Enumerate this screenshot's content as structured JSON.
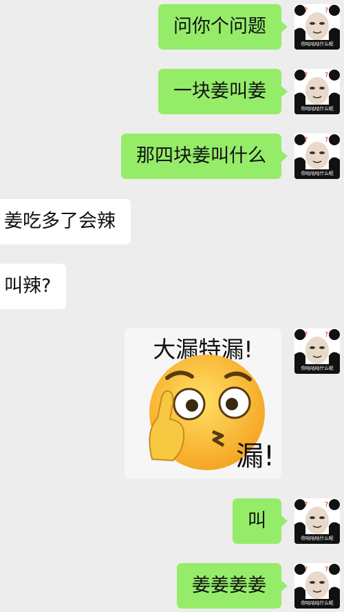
{
  "avatar_caption": "你咕咕咕什么呢",
  "messages": [
    {
      "side": "me",
      "text": "问你个问题"
    },
    {
      "side": "me",
      "text": "一块姜叫姜"
    },
    {
      "side": "me",
      "text": "那四块姜叫什么"
    },
    {
      "side": "other",
      "text": "姜吃多了会辣"
    },
    {
      "side": "other",
      "text": "叫辣?"
    },
    {
      "side": "me",
      "type": "sticker",
      "top_text": "大漏特漏!",
      "bottom_text": "漏!"
    },
    {
      "side": "me",
      "text": "叫"
    },
    {
      "side": "me",
      "text": "姜姜姜姜"
    }
  ]
}
